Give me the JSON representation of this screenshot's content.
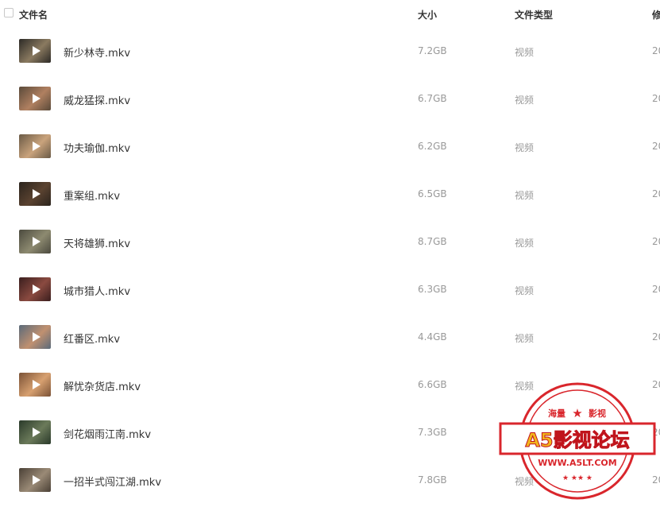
{
  "header": {
    "name_label": "文件名",
    "size_label": "大小",
    "type_label": "文件类型",
    "modified_label": "修"
  },
  "files": [
    {
      "name": "新少林寺.mkv",
      "size": "7.2GB",
      "type": "视频",
      "modified": "20",
      "thumb_colors": [
        "#2c2a26",
        "#8a7a60"
      ]
    },
    {
      "name": "威龙猛探.mkv",
      "size": "6.7GB",
      "type": "视频",
      "modified": "20",
      "thumb_colors": [
        "#5a4a3a",
        "#b08060"
      ]
    },
    {
      "name": "功夫瑜伽.mkv",
      "size": "6.2GB",
      "type": "视频",
      "modified": "20",
      "thumb_colors": [
        "#6a5a46",
        "#c9a37c"
      ]
    },
    {
      "name": "重案组.mkv",
      "size": "6.5GB",
      "type": "视频",
      "modified": "20",
      "thumb_colors": [
        "#2b241d",
        "#5a4230"
      ]
    },
    {
      "name": "天将雄狮.mkv",
      "size": "8.7GB",
      "type": "视频",
      "modified": "20",
      "thumb_colors": [
        "#4b4a3e",
        "#8d8a70"
      ]
    },
    {
      "name": "城市猎人.mkv",
      "size": "6.3GB",
      "type": "视频",
      "modified": "20",
      "thumb_colors": [
        "#3a1e1e",
        "#8a4a40"
      ]
    },
    {
      "name": "红番区.mkv",
      "size": "4.4GB",
      "type": "视频",
      "modified": "20",
      "thumb_colors": [
        "#5a6a7a",
        "#c09070"
      ]
    },
    {
      "name": "解忧杂货店.mkv",
      "size": "6.6GB",
      "type": "视频",
      "modified": "20",
      "thumb_colors": [
        "#7a5236",
        "#d7a070"
      ]
    },
    {
      "name": "剑花烟雨江南.mkv",
      "size": "7.3GB",
      "type": "视频",
      "modified": "20",
      "thumb_colors": [
        "#2a3a2a",
        "#6b7a5a"
      ]
    },
    {
      "name": "一招半式闯江湖.mkv",
      "size": "7.8GB",
      "type": "视频",
      "modified": "20",
      "thumb_colors": [
        "#4a4036",
        "#9a8a76"
      ]
    }
  ],
  "watermark": {
    "top_left_text": "海量",
    "top_right_text": "影视",
    "main_text": "A5影视论坛",
    "url_text": "WWW.A5LT.COM",
    "color": "#d9262c",
    "accent": "#f2b51c"
  }
}
